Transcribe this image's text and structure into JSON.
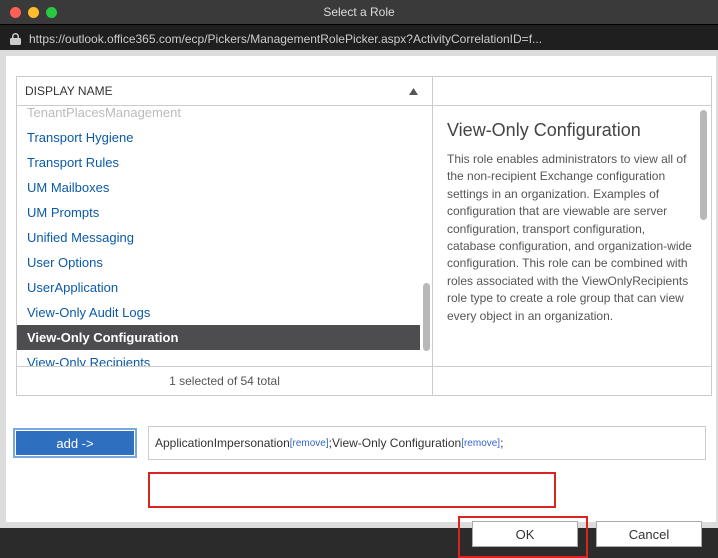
{
  "window": {
    "title": "Select a Role",
    "url": "https://outlook.office365.com/ecp/Pickers/ManagementRolePicker.aspx?ActivityCorrelationID=f..."
  },
  "left": {
    "header": "DISPLAY NAME",
    "items": [
      {
        "label": "TenantPlacesManagement",
        "cut": true
      },
      {
        "label": "Transport Hygiene"
      },
      {
        "label": "Transport Rules"
      },
      {
        "label": "UM Mailboxes"
      },
      {
        "label": "UM Prompts"
      },
      {
        "label": "Unified Messaging"
      },
      {
        "label": "User Options"
      },
      {
        "label": "UserApplication"
      },
      {
        "label": "View-Only Audit Logs"
      },
      {
        "label": "View-Only Configuration",
        "selected": true
      },
      {
        "label": "View-Only Recipients"
      }
    ],
    "footer": "1 selected of 54 total"
  },
  "right": {
    "title": "View-Only Configuration",
    "description": "This role enables administrators to view all of the non-recipient Exchange configuration settings in an organization. Examples of configuration that are viewable are server configuration, transport configuration, catabase configuration, and organization-wide configuration. This role can be combined with roles associated with the ViewOnlyRecipients role type to create a role group that can view every object in an organization."
  },
  "add": {
    "button": "add ->",
    "selections": [
      {
        "name": "ApplicationImpersonation",
        "action": "[remove]"
      },
      {
        "name": "View-Only Configuration",
        "action": "[remove]"
      }
    ]
  },
  "buttons": {
    "ok": "OK",
    "cancel": "Cancel"
  }
}
